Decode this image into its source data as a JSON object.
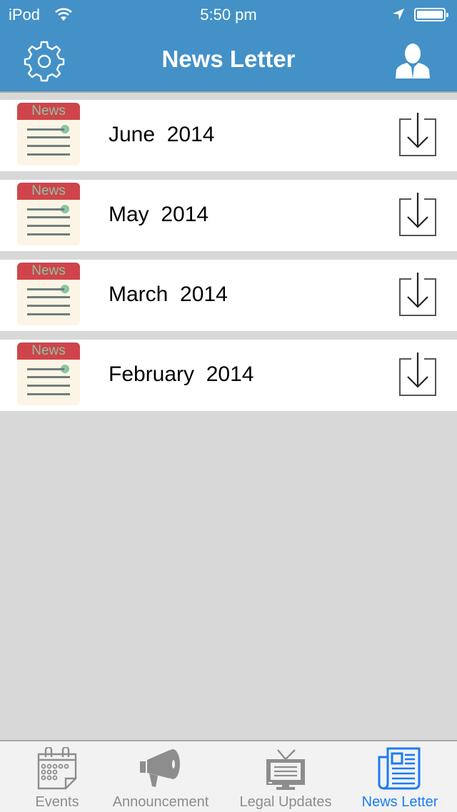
{
  "status_bar": {
    "carrier": "iPod",
    "time": "5:50 pm",
    "wifi_icon": "wifi-icon",
    "location_icon": "location-arrow-icon",
    "battery_icon": "battery-icon"
  },
  "nav": {
    "title": "News Letter",
    "left_icon": "gear-icon",
    "right_icon": "user-icon"
  },
  "newsletters": [
    {
      "icon_label": "News",
      "title": "June  2014",
      "action_icon": "download-icon"
    },
    {
      "icon_label": "News",
      "title": "May  2014",
      "action_icon": "download-icon"
    },
    {
      "icon_label": "News",
      "title": "March  2014",
      "action_icon": "download-icon"
    },
    {
      "icon_label": "News",
      "title": "February  2014",
      "action_icon": "download-icon"
    }
  ],
  "tabs": [
    {
      "label": "Events",
      "icon": "calendar-icon",
      "active": false
    },
    {
      "label": "Announcement",
      "icon": "megaphone-icon",
      "active": false
    },
    {
      "label": "Legal Updates",
      "icon": "tv-icon",
      "active": false
    },
    {
      "label": "News Letter",
      "icon": "newspaper-icon",
      "active": true
    }
  ],
  "colors": {
    "accent": "#4391c7",
    "active_tab": "#1a7cf2",
    "inactive_tab": "#8d8d8d",
    "icon_red": "#cf444b",
    "icon_green": "#8dc3a4"
  }
}
